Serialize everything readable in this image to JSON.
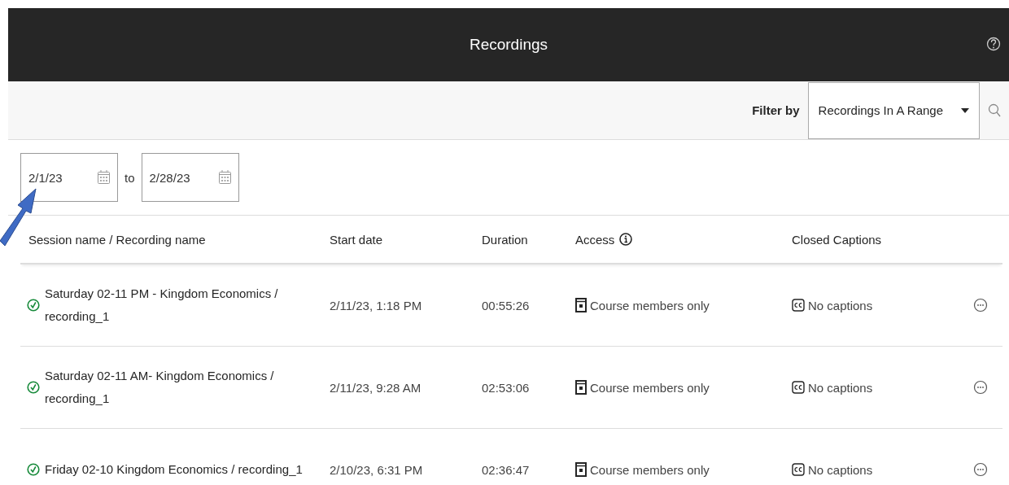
{
  "header": {
    "title": "Recordings"
  },
  "filter": {
    "label": "Filter by",
    "value": "Recordings In A Range"
  },
  "date_range": {
    "from": "2/1/23",
    "separator": "to",
    "to": "2/28/23"
  },
  "table": {
    "columns": [
      "Session name / Recording name",
      "Start date",
      "Duration",
      "Access",
      "Closed Captions"
    ],
    "rows": [
      {
        "name": "Saturday 02-11 PM - Kingdom Economics / recording_1",
        "start": "2/11/23, 1:18 PM",
        "duration": "00:55:26",
        "access": "Course members only",
        "captions": "No captions"
      },
      {
        "name": "Saturday 02-11 AM- Kingdom Economics / recording_1",
        "start": "2/11/23, 9:28 AM",
        "duration": "02:53:06",
        "access": "Course members only",
        "captions": "No captions"
      },
      {
        "name": "Friday 02-10 Kingdom Economics / recording_1",
        "start": "2/10/23, 6:31 PM",
        "duration": "02:36:47",
        "access": "Course members only",
        "captions": "No captions"
      }
    ]
  }
}
